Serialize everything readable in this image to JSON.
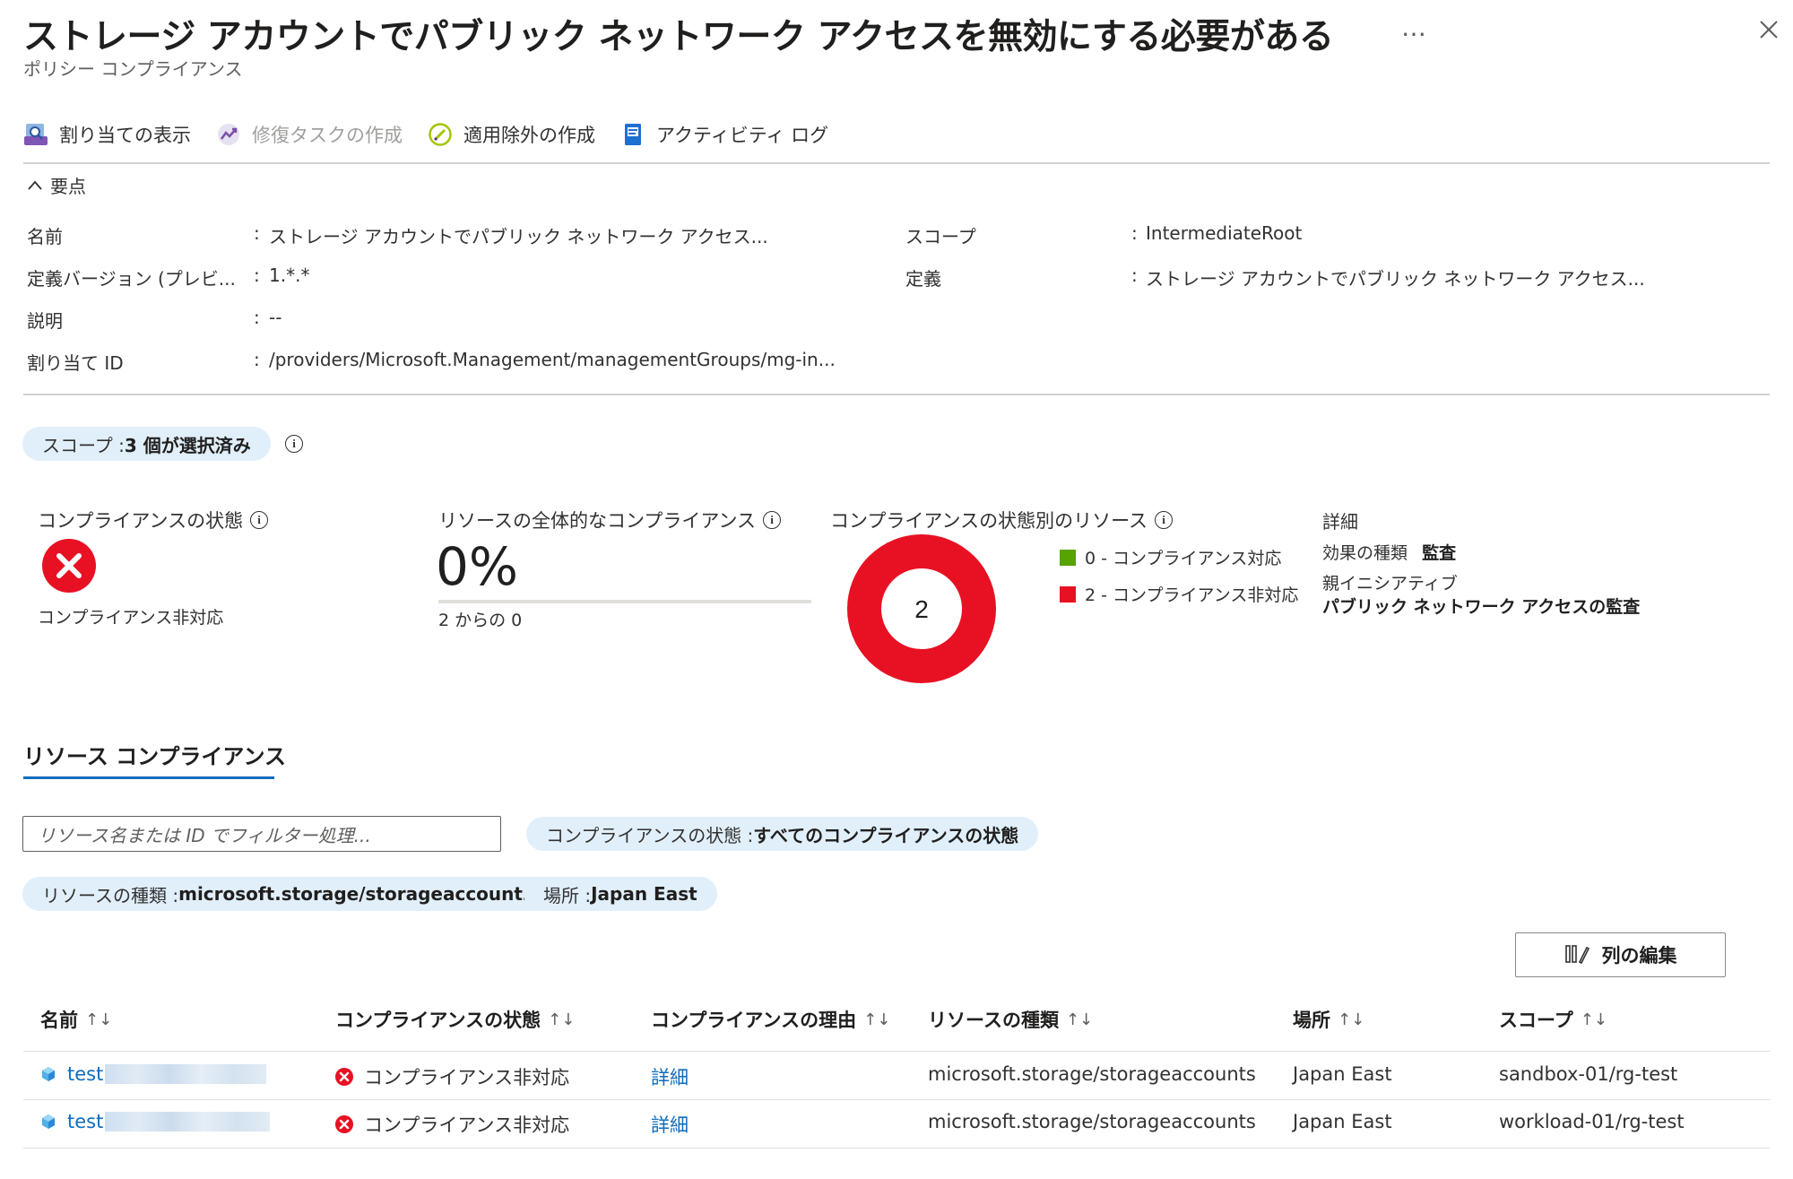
{
  "header": {
    "title": "ストレージ アカウントでパブリック ネットワーク アクセスを無効にする必要がある",
    "subtitle": "ポリシー コンプライアンス",
    "more": "…"
  },
  "toolbar": {
    "view_assignment": "割り当ての表示",
    "create_remediation": "修復タスクの作成",
    "create_exemption": "適用除外の作成",
    "activity_log": "アクティビティ ログ"
  },
  "essentials": {
    "toggle_label": "要点",
    "left": [
      {
        "label": "名前",
        "value": "ストレージ アカウントでパブリック ネットワーク アクセス..."
      },
      {
        "label": "定義バージョン (プレビ...",
        "value": "1.*.*"
      },
      {
        "label": "説明",
        "value": "--"
      },
      {
        "label": "割り当て ID",
        "value": "/providers/Microsoft.Management/managementGroups/mg-in..."
      }
    ],
    "right": [
      {
        "label": "スコープ",
        "value": "IntermediateRoot"
      },
      {
        "label": "定義",
        "value": "ストレージ アカウントでパブリック ネットワーク アクセス..."
      }
    ],
    "separator": ":"
  },
  "scope_pill": {
    "prefix": "スコープ : ",
    "value": "3 個が選択済み"
  },
  "summary": {
    "compliance_state": {
      "title": "コンプライアンスの状態",
      "status": "コンプライアンス非対応"
    },
    "overall": {
      "title": "リソースの全体的なコンプライアンス",
      "percent": "0%",
      "fraction": "2 からの 0",
      "fill_fraction": 0
    },
    "by_state": {
      "title": "コンプライアンスの状態別のリソース",
      "total": "2",
      "legend": [
        {
          "label": "0 - コンプライアンス対応",
          "color": "#57a300",
          "count": 0
        },
        {
          "label": "2 - コンプライアンス非対応",
          "color": "#e81123",
          "count": 2
        }
      ]
    },
    "details": {
      "title": "詳細",
      "effect_label": "効果の種類",
      "effect_value": "監査",
      "initiative_label": "親イニシアティブ",
      "initiative_value": "パブリック ネットワーク アクセスの監査"
    }
  },
  "tab": {
    "label": "リソース コンプライアンス"
  },
  "filters": {
    "search_placeholder": "リソース名または ID でフィルター処理...",
    "compliance_prefix": "コンプライアンスの状態 : ",
    "compliance_value": "すべてのコンプライアンスの状態",
    "type_prefix": "リソースの種類 : ",
    "type_value": "microsoft.storage/storageaccounts",
    "location_prefix": "場所 : ",
    "location_value": "Japan East"
  },
  "edit_columns": "列の編集",
  "table": {
    "columns": [
      "名前",
      "コンプライアンスの状態",
      "コンプライアンスの理由",
      "リソースの種類",
      "場所",
      "スコープ"
    ],
    "sort_glyph": "↑↓",
    "rows": [
      {
        "name": "test",
        "state": "コンプライアンス非対応",
        "reason": "詳細",
        "type": "microsoft.storage/storageaccounts",
        "location": "Japan East",
        "scope": "sandbox-01/rg-test"
      },
      {
        "name": "test",
        "state": "コンプライアンス非対応",
        "reason": "詳細",
        "type": "microsoft.storage/storageaccounts",
        "location": "Japan East",
        "scope": "workload-01/rg-test"
      }
    ]
  },
  "colors": {
    "accent": "#0f6cbd",
    "error": "#e81123",
    "success": "#57a300",
    "pill_bg": "#e1effa"
  }
}
